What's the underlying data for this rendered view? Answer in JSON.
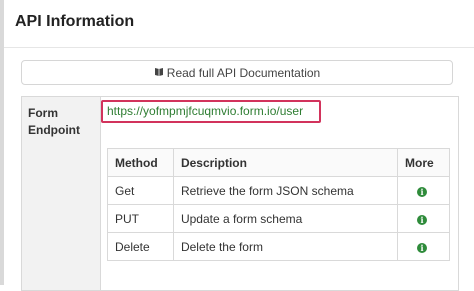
{
  "header": {
    "title": "API Information"
  },
  "doc_button": {
    "label": "Read full API Documentation",
    "icon": "book-icon"
  },
  "endpoint": {
    "label": "Form Endpoint",
    "url": "https://yofmpmjfcuqmvio.form.io/user"
  },
  "methods_table": {
    "headers": [
      "Method",
      "Description",
      "More"
    ],
    "rows": [
      {
        "method": "Get",
        "description": "Retrieve the form JSON schema",
        "more_icon": "info-icon"
      },
      {
        "method": "PUT",
        "description": "Update a form schema",
        "more_icon": "info-icon"
      },
      {
        "method": "Delete",
        "description": "Delete the form",
        "more_icon": "info-icon"
      }
    ]
  },
  "colors": {
    "highlight_border": "#d2335c",
    "link": "#2e7d32",
    "info_icon": "#2e8b3a"
  }
}
